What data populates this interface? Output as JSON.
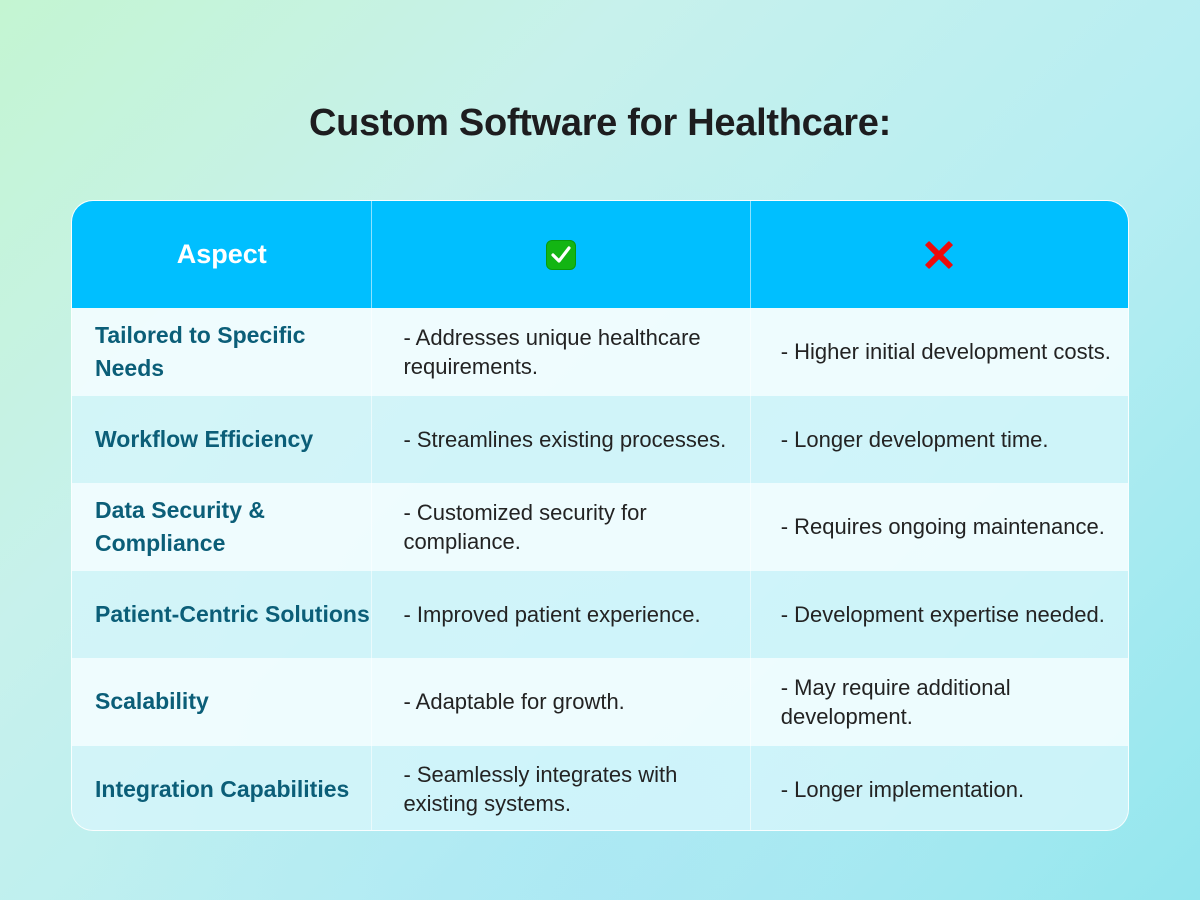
{
  "title": "Custom Software for Healthcare:",
  "table": {
    "headers": {
      "aspect": "Aspect",
      "pros_icon": "check-mark-button-icon",
      "cons_icon": "cross-mark-icon"
    },
    "colors": {
      "header_bg": "#00bfff",
      "aspect_text": "#0b5e78",
      "check_green": "#13b513",
      "cross_red": "#ee0b0b"
    },
    "rows": [
      {
        "aspect": "Tailored to Specific Needs",
        "pro": "- Addresses unique healthcare requirements.",
        "con": "- Higher initial development costs."
      },
      {
        "aspect": "Workflow Efficiency",
        "pro": "- Streamlines existing processes.",
        "con": "- Longer development time."
      },
      {
        "aspect": "Data Security & Compliance",
        "pro": "- Customized security for compliance.",
        "con": "- Requires ongoing maintenance."
      },
      {
        "aspect": "Patient-Centric Solutions",
        "pro": "- Improved patient experience.",
        "con": "- Development expertise needed."
      },
      {
        "aspect": "Scalability",
        "pro": "- Adaptable for growth.",
        "con": "- May require additional development."
      },
      {
        "aspect": "Integration Capabilities",
        "pro": "- Seamlessly integrates with existing systems.",
        "con": "- Longer implementation."
      }
    ]
  }
}
